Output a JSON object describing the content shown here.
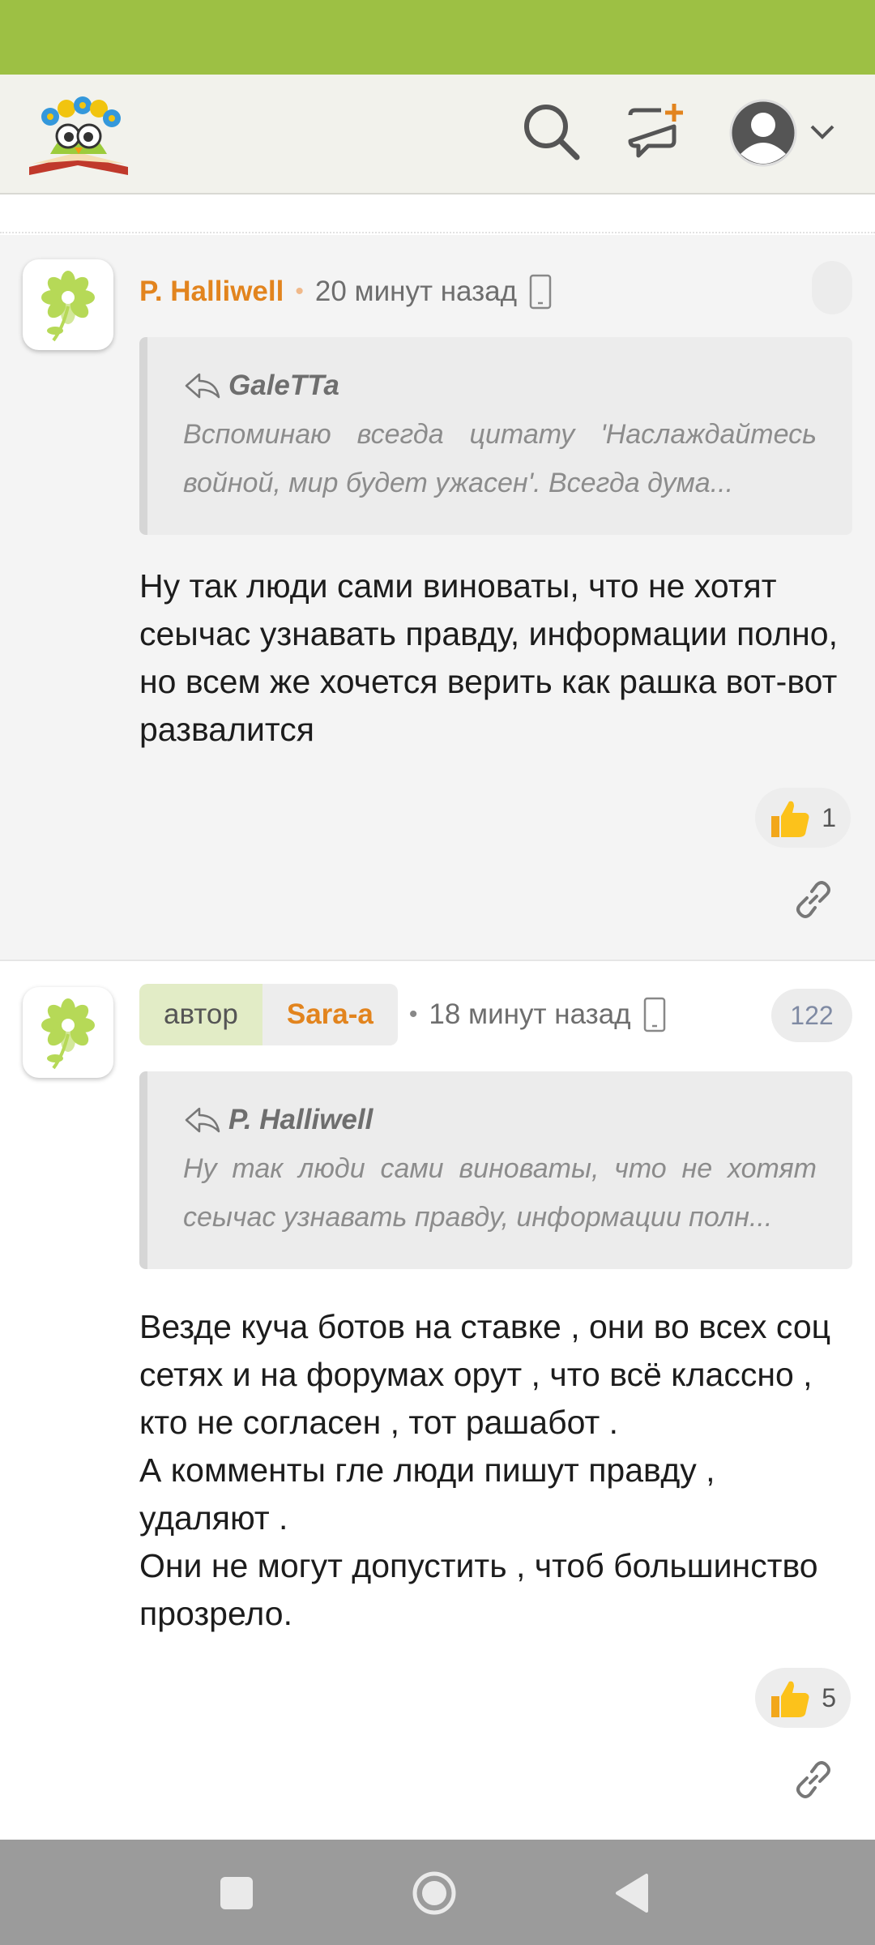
{
  "header": {
    "logo_icon": "reading-owl-logo",
    "icons": [
      "search-icon",
      "new-post-icon",
      "user-avatar-icon",
      "chevron-down-icon"
    ]
  },
  "colors": {
    "status_bar": "#9dc044",
    "author": "#e2841e",
    "header_bg": "#f2f2ec",
    "nav_bar": "#9b9b9b"
  },
  "comments": [
    {
      "author": "P. Halliwell",
      "time": "20 минут назад",
      "quote": {
        "author": "GaleTTa",
        "text": "Вспоминаю всегда цитату 'Наслаждайтесь войной, мир будет ужасен'. Всегда дума..."
      },
      "body": "Ну так люди сами виноваты, что не хотят сеычас узнавать правду, информации полно, но всем же хочется верить как рашка вот-вот развалится",
      "likes": "1"
    },
    {
      "role_tag": "автор",
      "author": "Sara-a",
      "time": "18 минут назад",
      "badge": "122",
      "quote": {
        "author": "P. Halliwell",
        "text": "Ну так люди сами виноваты, что не хотят сеычас узнавать правду, информации полн..."
      },
      "body": "Везде куча ботов на ставке , они во всех соц сетях и на форумах орут , что всё классно , кто не согласен , тот рашабот .\nА комменты гле люди пишут правду , удаляют .\nОни не могут допустить , чтоб большинство прозрело.",
      "likes": "5"
    }
  ],
  "navbar": {
    "buttons": [
      "recent-apps-icon",
      "home-icon",
      "back-icon"
    ]
  }
}
